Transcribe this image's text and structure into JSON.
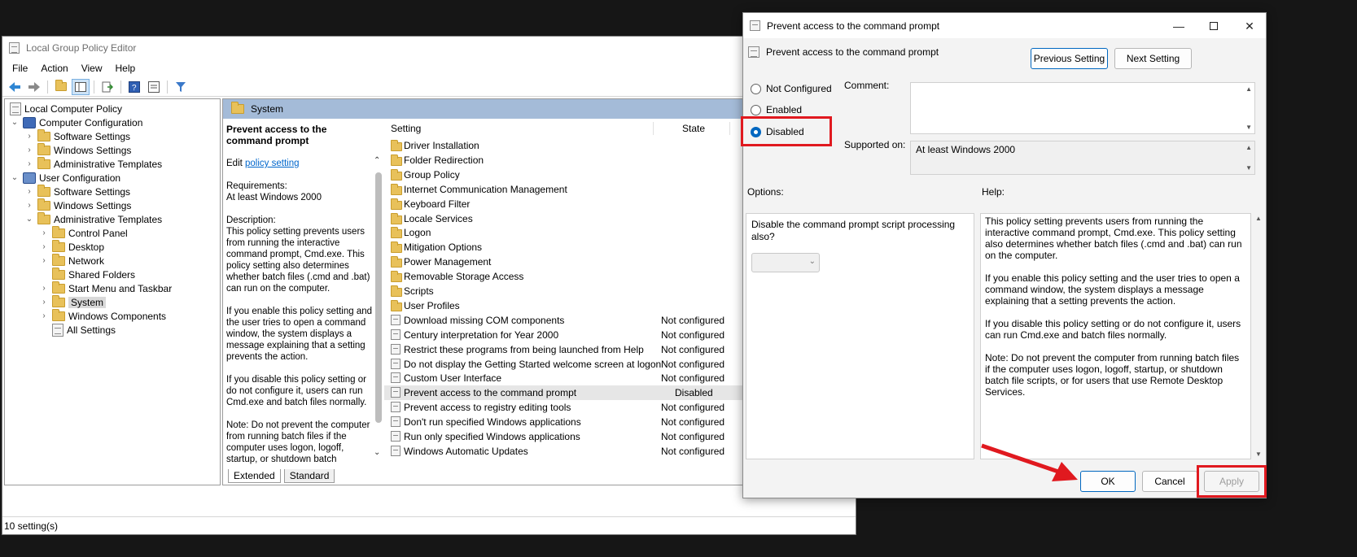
{
  "main_window": {
    "title": "Local Group Policy Editor",
    "menu": [
      "File",
      "Action",
      "View",
      "Help"
    ],
    "status": "10 setting(s)"
  },
  "tree": [
    {
      "label": "Local Computer Policy",
      "level": 0,
      "icon": "doc-icon",
      "chevron": ""
    },
    {
      "label": "Computer Configuration",
      "level": 0,
      "icon": "computer-icon",
      "chevron": "expanded"
    },
    {
      "label": "Software Settings",
      "level": 1,
      "icon": "folder-icon",
      "chevron": "collapsed"
    },
    {
      "label": "Windows Settings",
      "level": 1,
      "icon": "folder-icon",
      "chevron": "collapsed"
    },
    {
      "label": "Administrative Templates",
      "level": 1,
      "icon": "folder-icon",
      "chevron": "collapsed"
    },
    {
      "label": "User Configuration",
      "level": 0,
      "icon": "user-icon",
      "chevron": "expanded"
    },
    {
      "label": "Software Settings",
      "level": 1,
      "icon": "folder-icon",
      "chevron": "collapsed"
    },
    {
      "label": "Windows Settings",
      "level": 1,
      "icon": "folder-icon",
      "chevron": "collapsed"
    },
    {
      "label": "Administrative Templates",
      "level": 1,
      "icon": "folder-icon",
      "chevron": "expanded"
    },
    {
      "label": "Control Panel",
      "level": 2,
      "icon": "folder-icon",
      "chevron": "collapsed"
    },
    {
      "label": "Desktop",
      "level": 2,
      "icon": "folder-icon",
      "chevron": "collapsed"
    },
    {
      "label": "Network",
      "level": 2,
      "icon": "folder-icon",
      "chevron": "collapsed"
    },
    {
      "label": "Shared Folders",
      "level": 2,
      "icon": "folder-icon",
      "chevron": ""
    },
    {
      "label": "Start Menu and Taskbar",
      "level": 2,
      "icon": "folder-icon",
      "chevron": "collapsed"
    },
    {
      "label": "System",
      "level": 2,
      "icon": "folder-icon",
      "chevron": "collapsed",
      "selected": true
    },
    {
      "label": "Windows Components",
      "level": 2,
      "icon": "folder-icon",
      "chevron": "collapsed"
    },
    {
      "label": "All Settings",
      "level": 2,
      "icon": "doc-icon",
      "chevron": ""
    }
  ],
  "pane": {
    "header": "System",
    "desc_title": "Prevent access to the command prompt",
    "edit_prefix": "Edit ",
    "edit_link": "policy setting ",
    "requirements_label": "Requirements:",
    "requirements_value": "At least Windows 2000",
    "description_label": "Description:",
    "description_paras": [
      "This policy setting prevents users from running the interactive command prompt, Cmd.exe.  This policy setting also determines whether batch files (.cmd and .bat) can run on the computer.",
      "If you enable this policy setting and the user tries to open a command window, the system displays a message explaining that a setting prevents the action.",
      "If you disable this policy setting or do not configure it, users can run Cmd.exe and batch files normally.",
      "Note: Do not prevent the computer from running batch files if the computer uses logon, logoff, startup, or shutdown batch"
    ],
    "tabs": [
      "Extended",
      "Standard"
    ]
  },
  "list": {
    "col_setting": "Setting",
    "col_state": "State",
    "rows": [
      {
        "name": "Driver Installation",
        "state": "",
        "icon": "folder-icon"
      },
      {
        "name": "Folder Redirection",
        "state": "",
        "icon": "folder-icon"
      },
      {
        "name": "Group Policy",
        "state": "",
        "icon": "folder-icon"
      },
      {
        "name": "Internet Communication Management",
        "state": "",
        "icon": "folder-icon"
      },
      {
        "name": "Keyboard Filter",
        "state": "",
        "icon": "folder-icon"
      },
      {
        "name": "Locale Services",
        "state": "",
        "icon": "folder-icon"
      },
      {
        "name": "Logon",
        "state": "",
        "icon": "folder-icon"
      },
      {
        "name": "Mitigation Options",
        "state": "",
        "icon": "folder-icon"
      },
      {
        "name": "Power Management",
        "state": "",
        "icon": "folder-icon"
      },
      {
        "name": "Removable Storage Access",
        "state": "",
        "icon": "folder-icon"
      },
      {
        "name": "Scripts",
        "state": "",
        "icon": "folder-icon"
      },
      {
        "name": "User Profiles",
        "state": "",
        "icon": "folder-icon"
      },
      {
        "name": "Download missing COM components",
        "state": "Not configured",
        "icon": "policy-icon"
      },
      {
        "name": "Century interpretation for Year 2000",
        "state": "Not configured",
        "icon": "policy-icon"
      },
      {
        "name": "Restrict these programs from being launched from Help",
        "state": "Not configured",
        "icon": "policy-icon"
      },
      {
        "name": "Do not display the Getting Started welcome screen at logon",
        "state": "Not configured",
        "icon": "policy-icon"
      },
      {
        "name": "Custom User Interface",
        "state": "Not configured",
        "icon": "policy-icon"
      },
      {
        "name": "Prevent access to the command prompt",
        "state": "Disabled",
        "icon": "policy-icon",
        "selected": true
      },
      {
        "name": "Prevent access to registry editing tools",
        "state": "Not configured",
        "icon": "policy-icon"
      },
      {
        "name": "Don't run specified Windows applications",
        "state": "Not configured",
        "icon": "policy-icon"
      },
      {
        "name": "Run only specified Windows applications",
        "state": "Not configured",
        "icon": "policy-icon"
      },
      {
        "name": "Windows Automatic Updates",
        "state": "Not configured",
        "icon": "policy-icon"
      }
    ]
  },
  "dialog": {
    "title": "Prevent access to the command prompt",
    "setting_name": "Prevent access to the command prompt",
    "prev_button": "Previous Setting",
    "next_button": "Next Setting",
    "radio_not_configured": "Not Configured",
    "radio_enabled": "Enabled",
    "radio_disabled": "Disabled",
    "selected_option": "Disabled",
    "comment_label": "Comment:",
    "comment_value": "",
    "supported_label": "Supported on:",
    "supported_value": "At least Windows 2000",
    "options_label": "Options:",
    "help_label": "Help:",
    "option_question": "Disable the command prompt script processing also?",
    "help_paras": [
      "This policy setting prevents users from running the interactive command prompt, Cmd.exe.  This policy setting also determines whether batch files (.cmd and .bat) can run on the computer.",
      "If you enable this policy setting and the user tries to open a command window, the system displays a message explaining that a setting prevents the action.",
      "If you disable this policy setting or do not configure it, users can run Cmd.exe and batch files normally.",
      "Note: Do not prevent the computer from running batch files if the computer uses logon, logoff, startup, or shutdown batch file scripts, or for users that use Remote Desktop Services."
    ],
    "ok_button": "OK",
    "cancel_button": "Cancel",
    "apply_button": "Apply"
  },
  "colors": {
    "highlight_red": "#e0191f",
    "accent": "#0067c0",
    "pane_header": "#a4bbd8"
  }
}
